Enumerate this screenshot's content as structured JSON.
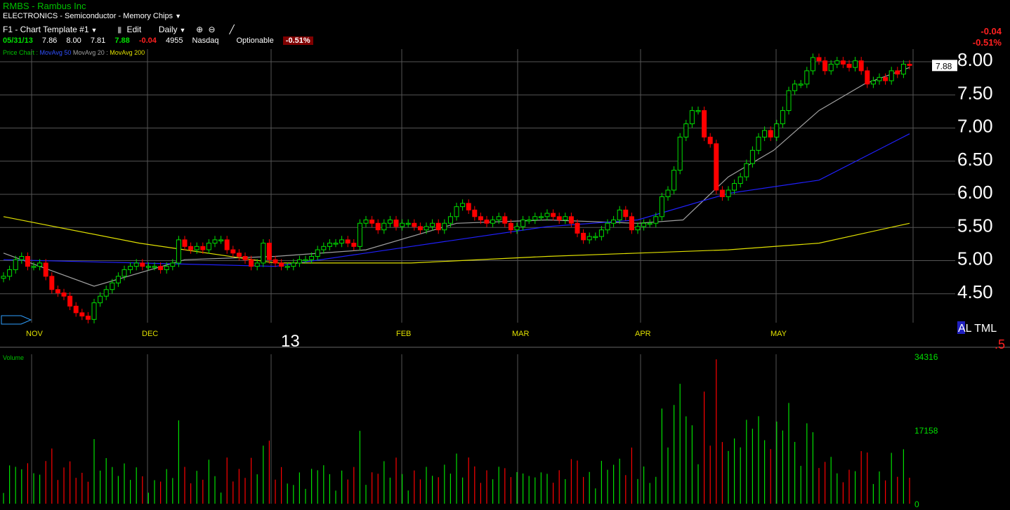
{
  "header": {
    "symbol_title": "RMBS - Rambus Inc",
    "industry": "ELECTRONICS - Semiconductor - Memory Chips",
    "template": "F1 - Chart Template #1",
    "edit_label": "Edit",
    "period": "Daily",
    "date": "05/31/13",
    "open": "7.86",
    "high": "8.00",
    "low": "7.81",
    "close": "7.88",
    "change": "-0.04",
    "volume": "4955",
    "exchange": "Nasdaq",
    "optionable": "Optionable",
    "pct_change": "-0.51%",
    "change_top": "-0.04",
    "pct_top": "-0.51%"
  },
  "legend": {
    "price_chart": "Price Chart :",
    "ma50": "MovAvg 50",
    "ma20": "MovAvg 20 :",
    "ma200": "MovAvg 200"
  },
  "colors": {
    "up": "#00e000",
    "down": "#ff0000",
    "ma20": "#a0a0a0",
    "ma50": "#2020ff",
    "ma200": "#e0e000",
    "grid": "#555555",
    "axis_text": "#ffffff",
    "month_text": "#e0e000",
    "volume_axis_text": "#00e000"
  },
  "chart_data": [
    {
      "type": "candlestick",
      "title": "",
      "price_axis": {
        "min": 4.0,
        "max": 8.0,
        "ticks": [
          "8.00",
          "7.50",
          "7.00",
          "6.50",
          "6.00",
          "5.50",
          "5.00",
          "4.50"
        ]
      },
      "month_labels": [
        "NOV",
        "DEC",
        "13",
        "FEB",
        "MAR",
        "APR",
        "MAY"
      ],
      "last_price_tag": "7.88",
      "corner_labels": {
        "altml": "AL TML",
        "small": ".5"
      },
      "series_daily_close": [
        4.7,
        4.8,
        4.95,
        5.0,
        4.85,
        4.85,
        4.9,
        4.7,
        4.5,
        4.45,
        4.4,
        4.25,
        4.15,
        4.1,
        4.05,
        4.3,
        4.4,
        4.5,
        4.6,
        4.7,
        4.8,
        4.85,
        4.9,
        4.85,
        4.85,
        4.85,
        4.8,
        4.85,
        4.9,
        5.25,
        5.15,
        5.1,
        5.15,
        5.1,
        5.2,
        5.25,
        5.25,
        5.1,
        5.05,
        5.0,
        4.95,
        4.85,
        4.9,
        5.2,
        4.95,
        4.9,
        4.85,
        4.85,
        4.9,
        4.95,
        4.95,
        5.0,
        5.1,
        5.15,
        5.2,
        5.2,
        5.25,
        5.2,
        5.15,
        5.5,
        5.55,
        5.5,
        5.4,
        5.5,
        5.55,
        5.45,
        5.5,
        5.5,
        5.45,
        5.4,
        5.45,
        5.5,
        5.4,
        5.5,
        5.6,
        5.75,
        5.8,
        5.7,
        5.6,
        5.55,
        5.5,
        5.55,
        5.6,
        5.5,
        5.4,
        5.45,
        5.55,
        5.55,
        5.6,
        5.6,
        5.65,
        5.6,
        5.55,
        5.6,
        5.5,
        5.35,
        5.25,
        5.3,
        5.3,
        5.4,
        5.5,
        5.55,
        5.7,
        5.6,
        5.4,
        5.45,
        5.5,
        5.5,
        5.6,
        5.9,
        6.0,
        6.3,
        6.8,
        7.0,
        7.2,
        7.2,
        6.8,
        6.7,
        6.0,
        5.9,
        6.0,
        6.1,
        6.2,
        6.4,
        6.6,
        6.8,
        6.9,
        6.8,
        7.0,
        7.2,
        7.5,
        7.6,
        7.6,
        7.8,
        8.0,
        7.95,
        7.8,
        7.9,
        7.95,
        7.9,
        7.85,
        7.95,
        7.8,
        7.6,
        7.65,
        7.7,
        7.65,
        7.8,
        7.75,
        7.9,
        7.88
      ],
      "series": [
        {
          "name": "MovAvg 20",
          "x_fraction": [
            0,
            0.1,
            0.2,
            0.3,
            0.4,
            0.5,
            0.6,
            0.7,
            0.75,
            0.8,
            0.85,
            0.9,
            0.95,
            1.0
          ],
          "values": [
            5.05,
            4.55,
            4.95,
            5.0,
            5.1,
            5.5,
            5.55,
            5.5,
            5.55,
            6.2,
            6.6,
            7.2,
            7.6,
            7.85
          ]
        },
        {
          "name": "MovAvg 50",
          "x_fraction": [
            0,
            0.15,
            0.3,
            0.45,
            0.6,
            0.7,
            0.8,
            0.9,
            1.0
          ],
          "values": [
            4.95,
            4.9,
            4.85,
            5.15,
            5.45,
            5.55,
            5.95,
            6.15,
            6.85
          ]
        },
        {
          "name": "MovAvg 200",
          "x_fraction": [
            0,
            0.15,
            0.3,
            0.45,
            0.6,
            0.7,
            0.8,
            0.9,
            1.0
          ],
          "values": [
            5.6,
            5.2,
            4.9,
            4.9,
            5.0,
            5.05,
            5.1,
            5.2,
            5.5
          ]
        }
      ]
    },
    {
      "type": "bar",
      "title": "Volume",
      "y_ticks": [
        "34316",
        "17158",
        "0"
      ],
      "ylim": [
        0,
        34316
      ]
    }
  ]
}
